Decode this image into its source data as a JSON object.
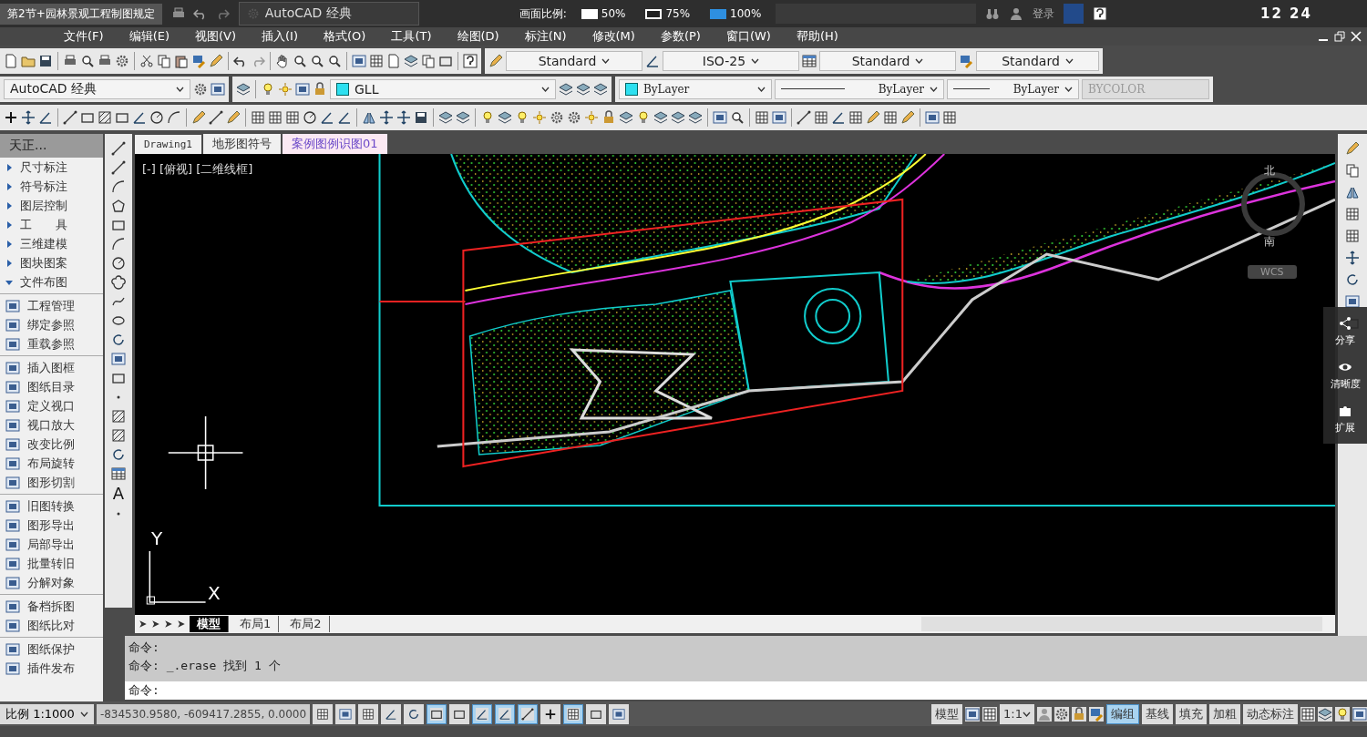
{
  "title_bar": {
    "document_title": "第2节+园林景观工程制图规定",
    "workspace": "AutoCAD 经典",
    "zoom_label": "画面比例:",
    "zoom_options": [
      {
        "label": "50%",
        "selected": false
      },
      {
        "label": "75%",
        "selected": false
      },
      {
        "label": "100%",
        "selected": true
      }
    ],
    "sign_in": "登录",
    "clock": "12 24"
  },
  "menu_bar": [
    "文件(F)",
    "编辑(E)",
    "视图(V)",
    "插入(I)",
    "格式(O)",
    "工具(T)",
    "绘图(D)",
    "标注(N)",
    "修改(M)",
    "参数(P)",
    "窗口(W)",
    "帮助(H)"
  ],
  "style_toolbar": {
    "text_style": "Standard",
    "dim_style": "ISO-25",
    "table_style": "Standard",
    "multileader_style": "Standard"
  },
  "properties_toolbar": {
    "workspace": "AutoCAD 经典",
    "layer": "GLL",
    "color_setting": "ByLayer",
    "linetype": "ByLayer",
    "lineweight": "ByLayer",
    "plot_style": "BYCOLOR",
    "plot_style_disabled": true
  },
  "side_panel": {
    "title": "天正...",
    "sections": [
      {
        "label": "尺寸标注",
        "expanded": false
      },
      {
        "label": "符号标注",
        "expanded": false
      },
      {
        "label": "图层控制",
        "expanded": false
      },
      {
        "label": "工　　具",
        "expanded": false
      },
      {
        "label": "三维建模",
        "expanded": false
      },
      {
        "label": "图块图案",
        "expanded": false
      },
      {
        "label": "文件布图",
        "expanded": true
      }
    ],
    "command_groups": [
      [
        "工程管理",
        "绑定参照",
        "重载参照"
      ],
      [
        "插入图框",
        "图纸目录",
        "定义视口",
        "视口放大",
        "改变比例",
        "布局旋转",
        "图形切割"
      ],
      [
        "旧图转换",
        "图形导出",
        "局部导出",
        "批量转旧",
        "分解对象"
      ],
      [
        "备档拆图",
        "图纸比对"
      ],
      [
        "图纸保护",
        "插件发布"
      ]
    ]
  },
  "draw_toolbar": {
    "text_tool_glyph": "A"
  },
  "file_tabs": [
    {
      "label": "Drawing1",
      "selected": false
    },
    {
      "label": "地形图符号",
      "selected": false
    },
    {
      "label": "案例图例识图01",
      "selected": true
    }
  ],
  "viewport_label": "[-] [俯视] [二维线框]",
  "compass": {
    "north": "北",
    "south": "南",
    "wcs": "WCS"
  },
  "ucs": {
    "x": "X",
    "y": "Y"
  },
  "player_buttons": [
    "分享",
    "清晰度",
    "扩展"
  ],
  "layout_tabs": [
    {
      "label": "模型",
      "selected": true
    },
    {
      "label": "布局1",
      "selected": false
    },
    {
      "label": "布局2",
      "selected": false
    }
  ],
  "command_history": [
    "命令:",
    "命令: _.erase 找到 1 个"
  ],
  "command_prompt": "命令:",
  "status_bar": {
    "scale": "比例 1:1000",
    "coordinates": "-834530.9580, -609417.2855, 0.0000",
    "drafting_toggles": [
      {
        "on": false
      },
      {
        "on": false
      },
      {
        "on": false
      },
      {
        "on": false
      },
      {
        "on": false
      },
      {
        "on": true
      },
      {
        "on": false
      },
      {
        "on": true
      },
      {
        "on": true
      },
      {
        "on": true
      },
      {
        "on": false
      },
      {
        "on": true
      },
      {
        "on": false
      },
      {
        "on": false
      }
    ],
    "model": "模型",
    "annotation_scale": "1:1",
    "text_toggles": [
      {
        "label": "编组",
        "on": true
      },
      {
        "label": "基线",
        "on": false
      },
      {
        "label": "填充",
        "on": false
      },
      {
        "label": "加粗",
        "on": false
      },
      {
        "label": "动态标注",
        "on": false
      }
    ]
  }
}
